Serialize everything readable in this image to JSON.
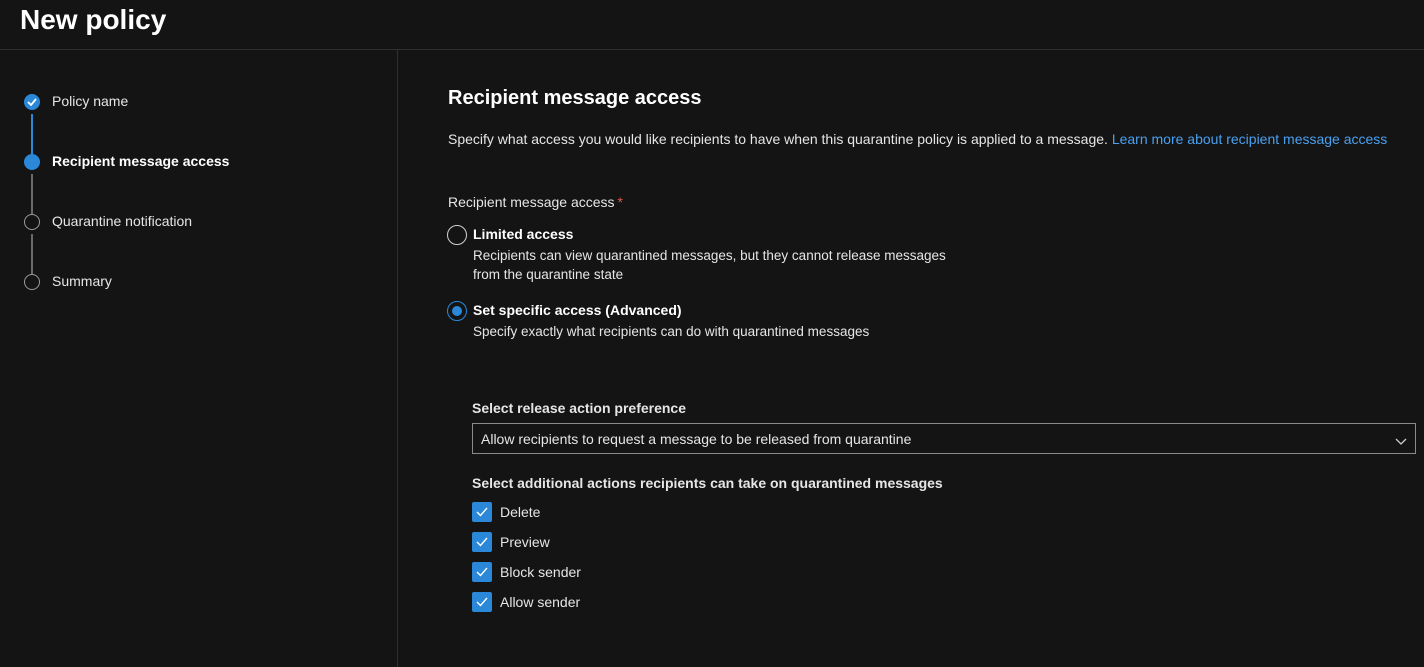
{
  "header": {
    "title": "New policy"
  },
  "wizard": {
    "steps": [
      {
        "label": "Policy name",
        "state": "done"
      },
      {
        "label": "Recipient message access",
        "state": "current"
      },
      {
        "label": "Quarantine notification",
        "state": "pending"
      },
      {
        "label": "Summary",
        "state": "pending"
      }
    ]
  },
  "main": {
    "title": "Recipient message access",
    "description": "Specify what access you would like recipients to have when this quarantine policy is applied to a message.",
    "learn_more_link": "Learn more about recipient message access",
    "access_field": {
      "label": "Recipient message access",
      "required_marker": "*",
      "options": [
        {
          "title": "Limited access",
          "description": "Recipients can view quarantined messages, but they cannot release messages from the quarantine state",
          "selected": false
        },
        {
          "title": "Set specific access (Advanced)",
          "description": "Specify exactly what recipients can do with quarantined messages",
          "selected": true
        }
      ]
    },
    "release_action": {
      "label": "Select release action preference",
      "value": "Allow recipients to request a message to be released from quarantine"
    },
    "additional_actions": {
      "label": "Select additional actions recipients can take on quarantined messages",
      "items": [
        {
          "label": "Delete",
          "checked": true
        },
        {
          "label": "Preview",
          "checked": true
        },
        {
          "label": "Block sender",
          "checked": true
        },
        {
          "label": "Allow sender",
          "checked": true
        }
      ]
    }
  },
  "colors": {
    "accent": "#2b88d8",
    "link": "#4aa0f0",
    "required": "#e05a4b",
    "background": "#141414"
  }
}
